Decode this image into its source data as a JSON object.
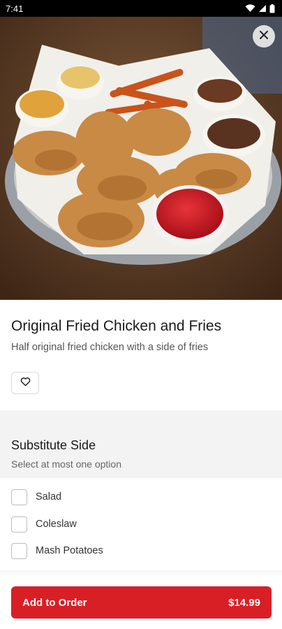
{
  "status": {
    "time": "7:41"
  },
  "icons": {
    "wifi": "wifi-icon",
    "signal": "signal-icon",
    "battery": "battery-icon",
    "close": "close-icon",
    "heart": "heart-icon"
  },
  "item": {
    "title": "Original Fried Chicken and Fries",
    "description": "Half original fried chicken with a side of fries"
  },
  "section": {
    "title": "Substitute Side",
    "subtitle": "Select at most one option",
    "options": [
      {
        "label": "Salad",
        "checked": false
      },
      {
        "label": "Coleslaw",
        "checked": false
      },
      {
        "label": "Mash Potatoes",
        "checked": false
      }
    ]
  },
  "cta": {
    "label": "Add to Order",
    "price": "$14.99",
    "color": "#d81f26"
  }
}
